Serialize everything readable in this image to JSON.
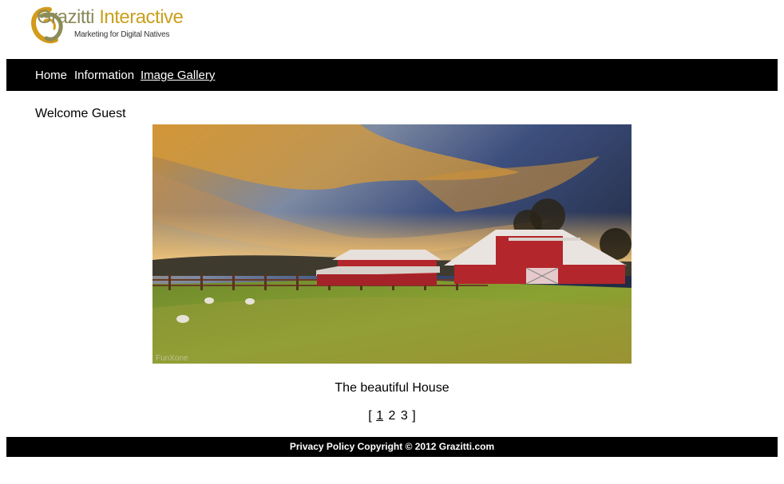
{
  "header": {
    "logo": {
      "name_part1": "Grazitti",
      "name_part2": "Interactive",
      "tagline": "Marketing for Digital Natives"
    }
  },
  "nav": {
    "items": [
      {
        "label": "Home"
      },
      {
        "label": "Information"
      },
      {
        "label": "Image Gallery",
        "active": true
      }
    ]
  },
  "main": {
    "welcome": "Welcome Guest",
    "image": {
      "watermark": "FunXone"
    },
    "caption": "The beautiful House",
    "pager": {
      "open": "[",
      "pages": [
        "1",
        "2",
        "3"
      ],
      "current": "1",
      "close": "]"
    }
  },
  "footer": {
    "text": "Privacy Policy Copyright © 2012 Grazitti.com"
  },
  "colors": {
    "nav_bg": "#000000",
    "logo_gold": "#c9a01e",
    "barn_red": "#b3262b"
  }
}
